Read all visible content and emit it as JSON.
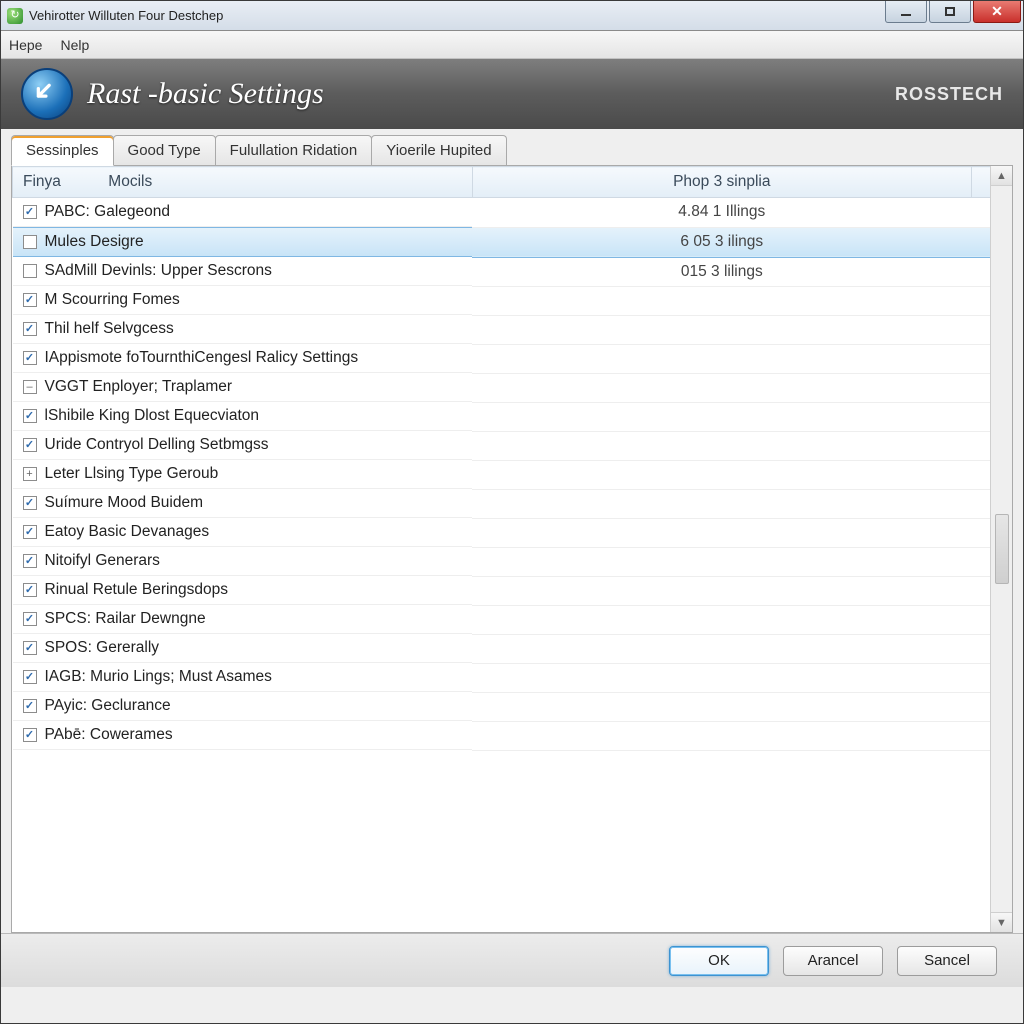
{
  "window": {
    "title": "Vehirotter Willuten Four Destchep"
  },
  "menubar": {
    "items": [
      "Hepe",
      "Nelp"
    ]
  },
  "header": {
    "title": "Rast -basic Settings",
    "brand": "ROSSTECH"
  },
  "tabs": [
    {
      "label": "Sessinples",
      "active": true
    },
    {
      "label": "Good Type",
      "active": false
    },
    {
      "label": "Fulullation Ridation",
      "active": false
    },
    {
      "label": "Yioerile Hupited",
      "active": false
    }
  ],
  "table": {
    "columns": [
      "Finya",
      "Mocils",
      "Phop 3 sinplia"
    ],
    "rows": [
      {
        "check": "checked",
        "name": "PABC: Galegeond",
        "value": "4.84 1 Illings",
        "selected": false
      },
      {
        "check": "empty",
        "name": "Mules Desigre",
        "value": "6 05 3 ilings",
        "selected": true
      },
      {
        "check": "empty",
        "name": "SAdMill Devinls: Upper Sescrons",
        "value": "015 3 lilings",
        "selected": false
      },
      {
        "check": "checked",
        "name": "M Scourring Fomes",
        "value": "",
        "selected": false
      },
      {
        "check": "checked",
        "name": "Thil helf Selvgcess",
        "value": "",
        "selected": false
      },
      {
        "check": "checked",
        "name": "IAppismote foTournthiCengesl Ralicy Settings",
        "value": "",
        "selected": false
      },
      {
        "check": "dash",
        "name": "VGGT Enployer; Traplamer",
        "value": "",
        "selected": false
      },
      {
        "check": "checked",
        "name": "lShibile King Dlost Equecviaton",
        "value": "",
        "selected": false
      },
      {
        "check": "checked",
        "name": "Uride Contryol Delling Setbmgss",
        "value": "",
        "selected": false
      },
      {
        "check": "plus",
        "name": "Leter Llsing Type Geroub",
        "value": "",
        "selected": false
      },
      {
        "check": "checked",
        "name": "Suímure Mood Buidem",
        "value": "",
        "selected": false
      },
      {
        "check": "checked",
        "name": "Eatoy Basic Devanages",
        "value": "",
        "selected": false
      },
      {
        "check": "checked",
        "name": "Nitoifyl Generars",
        "value": "",
        "selected": false
      },
      {
        "check": "checked",
        "name": "Rinual Retule Beringsdops",
        "value": "",
        "selected": false
      },
      {
        "check": "checked",
        "name": "SPCS: Railar Dewngne",
        "value": "",
        "selected": false
      },
      {
        "check": "checked",
        "name": "SPOS: Gererally",
        "value": "",
        "selected": false
      },
      {
        "check": "checked",
        "name": "IAGB: Murio Lings; Must Asames",
        "value": "",
        "selected": false
      },
      {
        "check": "checked",
        "name": "PAyic: Geclurance",
        "value": "",
        "selected": false
      },
      {
        "check": "checked",
        "name": "PAbē: Cowerames",
        "value": "",
        "selected": false
      }
    ]
  },
  "footer": {
    "ok": "OK",
    "arancel": "Arancel",
    "sancel": "Sancel"
  }
}
